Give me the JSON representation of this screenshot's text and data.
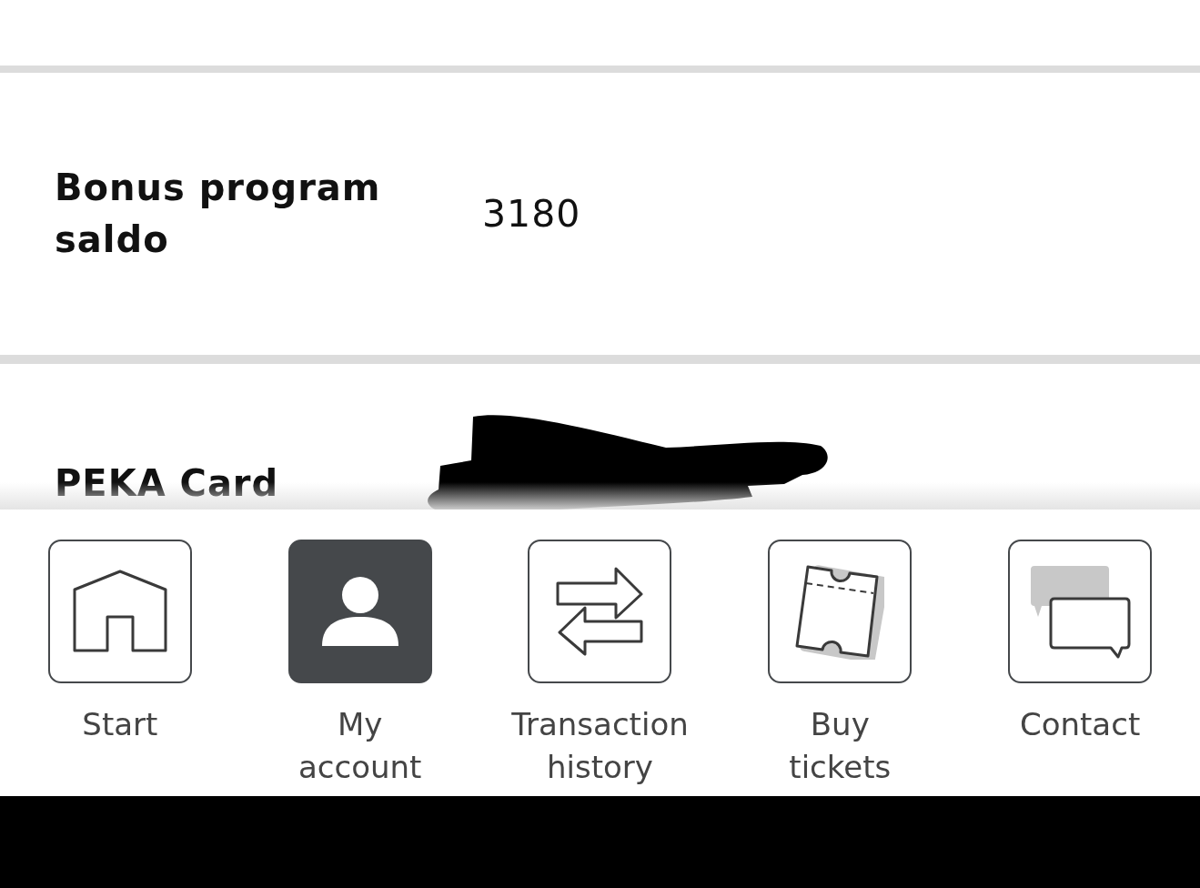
{
  "rows": [
    {
      "label": "Bonus program saldo",
      "value": "3180"
    },
    {
      "label": "PEKA Card",
      "redacted": true
    }
  ],
  "nav": [
    {
      "kind": "home",
      "label": "Start",
      "selected": false
    },
    {
      "kind": "person",
      "label": "My account",
      "selected": true
    },
    {
      "kind": "transfer",
      "label": "Transaction history",
      "selected": false
    },
    {
      "kind": "ticket",
      "label": "Buy tickets",
      "selected": false
    },
    {
      "kind": "chat",
      "label": "Contact",
      "selected": false
    }
  ]
}
